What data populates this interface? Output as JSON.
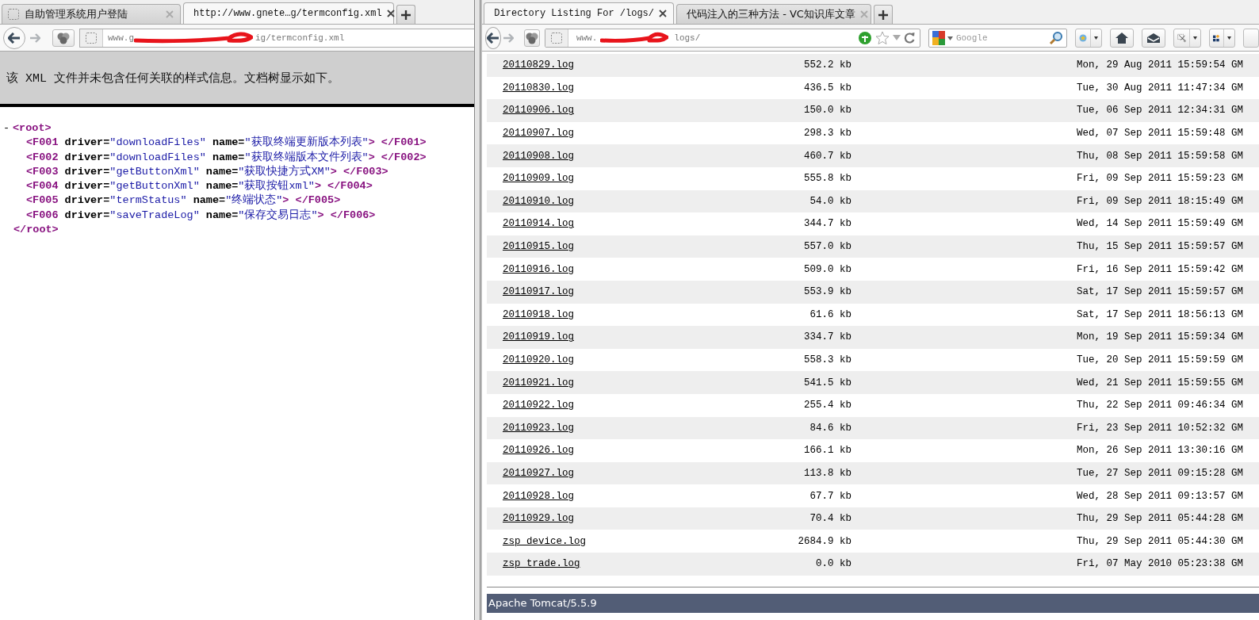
{
  "left_window": {
    "tabs": [
      {
        "title": "自助管理系统用户登陆",
        "selected": false
      },
      {
        "title": "http://www.gnete…g/termconfig.xml",
        "selected": true
      }
    ],
    "address": {
      "visible_start": "www.g",
      "visible_end": "ig/termconfig.xml"
    },
    "notice": "该 XML 文件并未包含任何关联的样式信息。文档树显示如下。",
    "xml": {
      "toggle": "-",
      "open": "<root>",
      "close": "</root>",
      "lines": [
        [
          {
            "kind": "tag",
            "text": "<F001"
          },
          {
            "kind": "attr",
            "text": " driver="
          },
          {
            "kind": "value",
            "text": "\"downloadFiles\""
          },
          {
            "kind": "attr",
            "text": " name="
          },
          {
            "kind": "value",
            "text": "\"获取终端更新版本列表\""
          },
          {
            "kind": "tag",
            "text": "> </F001>"
          }
        ],
        [
          {
            "kind": "tag",
            "text": "<F002"
          },
          {
            "kind": "attr",
            "text": " driver="
          },
          {
            "kind": "value",
            "text": "\"downloadFiles\""
          },
          {
            "kind": "attr",
            "text": " name="
          },
          {
            "kind": "value",
            "text": "\"获取终端版本文件列表\""
          },
          {
            "kind": "tag",
            "text": "> </F002>"
          }
        ],
        [
          {
            "kind": "tag",
            "text": "<F003"
          },
          {
            "kind": "attr",
            "text": " driver="
          },
          {
            "kind": "value",
            "text": "\"getButtonXml\""
          },
          {
            "kind": "attr",
            "text": " name="
          },
          {
            "kind": "value",
            "text": "\"获取快捷方式XM\""
          },
          {
            "kind": "tag",
            "text": "> </F003>"
          }
        ],
        [
          {
            "kind": "tag",
            "text": "<F004"
          },
          {
            "kind": "attr",
            "text": " driver="
          },
          {
            "kind": "value",
            "text": "\"getButtonXml\""
          },
          {
            "kind": "attr",
            "text": " name="
          },
          {
            "kind": "value",
            "text": "\"获取按钮xml\""
          },
          {
            "kind": "tag",
            "text": "> </F004>"
          }
        ],
        [
          {
            "kind": "tag",
            "text": "<F005"
          },
          {
            "kind": "attr",
            "text": " driver="
          },
          {
            "kind": "value",
            "text": "\"termStatus\""
          },
          {
            "kind": "attr",
            "text": " name="
          },
          {
            "kind": "value",
            "text": "\"终端状态\""
          },
          {
            "kind": "tag",
            "text": "> </F005>"
          }
        ],
        [
          {
            "kind": "tag",
            "text": "<F006"
          },
          {
            "kind": "attr",
            "text": " driver="
          },
          {
            "kind": "value",
            "text": "\"saveTradeLog\""
          },
          {
            "kind": "attr",
            "text": " name="
          },
          {
            "kind": "value",
            "text": "\"保存交易日志\""
          },
          {
            "kind": "tag",
            "text": "> </F006>"
          }
        ]
      ]
    }
  },
  "right_window": {
    "tabs": [
      {
        "title": "Directory Listing For /logs/",
        "selected": true
      },
      {
        "title": "代码注入的三种方法 - VC知识库文章",
        "selected": false
      }
    ],
    "address": {
      "visible_start": "www.",
      "visible_end": "logs/"
    },
    "search": {
      "placeholder": "Google"
    },
    "rows": [
      {
        "name": "20110829.log",
        "size": "552.2 kb",
        "modified": "Mon, 29 Aug 2011 15:59:54 GM"
      },
      {
        "name": "20110830.log",
        "size": "436.5 kb",
        "modified": "Tue, 30 Aug 2011 11:47:34 GM"
      },
      {
        "name": "20110906.log",
        "size": "150.0 kb",
        "modified": "Tue, 06 Sep 2011 12:34:31 GM"
      },
      {
        "name": "20110907.log",
        "size": "298.3 kb",
        "modified": "Wed, 07 Sep 2011 15:59:48 GM"
      },
      {
        "name": "20110908.log",
        "size": "460.7 kb",
        "modified": "Thu, 08 Sep 2011 15:59:58 GM"
      },
      {
        "name": "20110909.log",
        "size": "555.8 kb",
        "modified": "Fri, 09 Sep 2011 15:59:23 GM"
      },
      {
        "name": "20110910.log",
        "size": "54.0 kb",
        "modified": "Fri, 09 Sep 2011 18:15:49 GM"
      },
      {
        "name": "20110914.log",
        "size": "344.7 kb",
        "modified": "Wed, 14 Sep 2011 15:59:49 GM"
      },
      {
        "name": "20110915.log",
        "size": "557.0 kb",
        "modified": "Thu, 15 Sep 2011 15:59:57 GM"
      },
      {
        "name": "20110916.log",
        "size": "509.0 kb",
        "modified": "Fri, 16 Sep 2011 15:59:42 GM"
      },
      {
        "name": "20110917.log",
        "size": "553.9 kb",
        "modified": "Sat, 17 Sep 2011 15:59:57 GM"
      },
      {
        "name": "20110918.log",
        "size": "61.6 kb",
        "modified": "Sat, 17 Sep 2011 18:56:13 GM"
      },
      {
        "name": "20110919.log",
        "size": "334.7 kb",
        "modified": "Mon, 19 Sep 2011 15:59:34 GM"
      },
      {
        "name": "20110920.log",
        "size": "558.3 kb",
        "modified": "Tue, 20 Sep 2011 15:59:59 GM"
      },
      {
        "name": "20110921.log",
        "size": "541.5 kb",
        "modified": "Wed, 21 Sep 2011 15:59:55 GM"
      },
      {
        "name": "20110922.log",
        "size": "255.4 kb",
        "modified": "Thu, 22 Sep 2011 09:46:34 GM"
      },
      {
        "name": "20110923.log",
        "size": "84.6 kb",
        "modified": "Fri, 23 Sep 2011 10:52:32 GM"
      },
      {
        "name": "20110926.log",
        "size": "166.1 kb",
        "modified": "Mon, 26 Sep 2011 13:30:16 GM"
      },
      {
        "name": "20110927.log",
        "size": "113.8 kb",
        "modified": "Tue, 27 Sep 2011 09:15:28 GM"
      },
      {
        "name": "20110928.log",
        "size": "67.7 kb",
        "modified": "Wed, 28 Sep 2011 09:13:57 GM"
      },
      {
        "name": "20110929.log",
        "size": "70.4 kb",
        "modified": "Thu, 29 Sep 2011 05:44:28 GM"
      },
      {
        "name": "zsp_device.log",
        "size": "2684.9 kb",
        "modified": "Thu, 29 Sep 2011 05:44:30 GM"
      },
      {
        "name": "zsp_trade.log",
        "size": "0.0 kb",
        "modified": "Fri, 07 May 2010 05:23:38 GM"
      }
    ],
    "footer": "Apache Tomcat/5.5.9"
  }
}
